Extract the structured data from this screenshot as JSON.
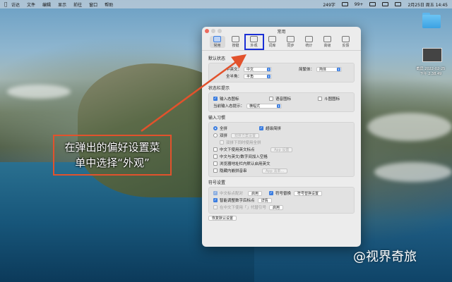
{
  "menubar": {
    "items": [
      "访达",
      "文件",
      "编辑",
      "显示",
      "前往",
      "窗口",
      "帮助"
    ],
    "right": {
      "cpu": "249字",
      "battery": "99+",
      "clock": "2月25日 周五 14:45"
    }
  },
  "desktop": {
    "screenshot_label": "截屏 2022-02-25\n下午 2.38.49"
  },
  "window": {
    "title": "常用",
    "toolbar": [
      {
        "label": "常用",
        "active": true,
        "selected": false
      },
      {
        "label": "按键",
        "active": false,
        "selected": false
      },
      {
        "label": "外观",
        "active": false,
        "selected": true
      },
      {
        "label": "词库",
        "active": false,
        "selected": false
      },
      {
        "label": "同步",
        "active": false,
        "selected": false
      },
      {
        "label": "统计",
        "active": false,
        "selected": false
      },
      {
        "label": "高级",
        "active": false,
        "selected": false
      },
      {
        "label": "反馈",
        "active": false,
        "selected": false
      }
    ],
    "default_state": {
      "title": "默认状态",
      "cn_en_label": "中英文：",
      "cn_en_value": "中文",
      "simp_trad_label": "简繁体：",
      "simp_trad_value": "简体",
      "fullhalf_label": "全半角：",
      "fullhalf_value": "半角"
    },
    "status_bar": {
      "title": "状态栏提示",
      "input_icon": "输入态图标",
      "voice_icon": "语音图标",
      "doutu_icon": "斗图图标",
      "hint_label": "当前输入态提示：",
      "hint_value": "横幅式"
    },
    "input_habits": {
      "title": "输入习惯",
      "quanpin": "全拼",
      "super_simple": "超级简拼",
      "shuangpin": "双拼",
      "scheme_btn": "双拼方案设置",
      "shuangpin_sub": "双拼下同时使用全拼",
      "cn_en_punct": "中文下使用英文标点",
      "app_settings": "App 设置",
      "space_between": "中文与英文/数字间加入空格",
      "browser_en": "浏览器地址栏内默认启用英文",
      "hide_candidate": "隐藏内嵌拼音串",
      "app_list": "App 清单..."
    },
    "symbols": {
      "title": "符号设置",
      "cn_punct_pair": "中文标点配对",
      "enable": "启用",
      "symbol_replace": "符号替换",
      "symbol_replace_btn": "符号替换设置",
      "smart_punct": "智能调整数字后标点",
      "detail": "详情",
      "quote_replace": "在中文下使用「」代替引号",
      "enable2": "启用"
    },
    "restore": "恢复默认设置"
  },
  "annotation": {
    "line1": "在弹出的偏好设置菜",
    "line2": "单中选择“外观”"
  },
  "watermark": "@视界奇旅",
  "colors": {
    "annotation": "#e2522c",
    "highlight": "#1a2fd6",
    "accent": "#3b7de0"
  }
}
